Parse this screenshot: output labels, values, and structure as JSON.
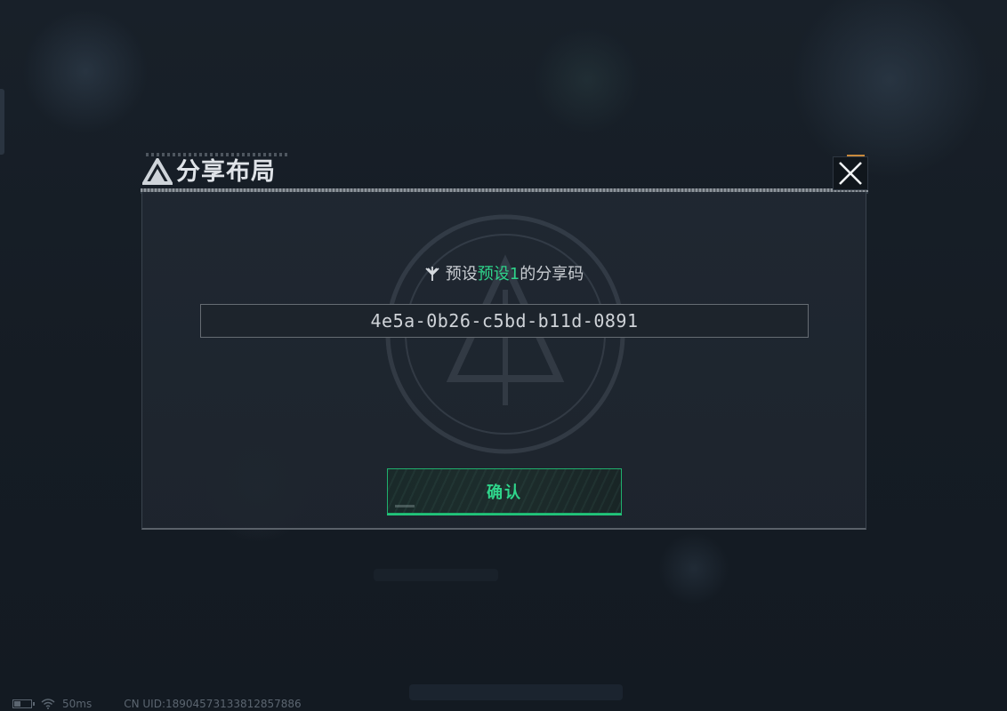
{
  "dialog": {
    "title": "分享布局",
    "subtitle_prefix": "预设",
    "preset_name": "预设1",
    "subtitle_suffix": "的分享码",
    "share_code": "4e5a-0b26-c5bd-b11d-0891",
    "confirm_label": "确认"
  },
  "status_bar": {
    "ping": "50ms",
    "uid": "CN UID:1890457313381285788​6"
  },
  "colors": {
    "accent_green": "#2ed38a",
    "panel_bg": "#1e252e",
    "title_text": "#dfe3e8"
  },
  "icons": {
    "title_logo": "triangle-logo-icon",
    "close": "close-icon",
    "subtitle": "emblem-icon",
    "battery": "battery-icon",
    "wifi": "wifi-icon"
  }
}
